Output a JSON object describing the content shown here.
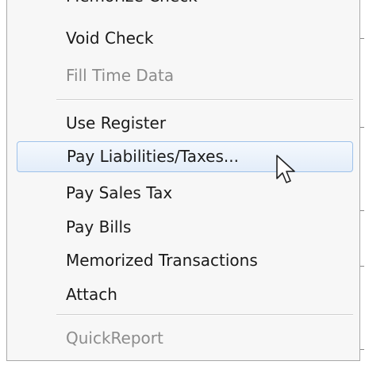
{
  "menu": {
    "clipped_item": "Memorize Check",
    "items": [
      {
        "label": "Void Check",
        "enabled": true
      },
      {
        "label": "Fill Time Data",
        "enabled": false
      },
      {
        "label": "Use Register",
        "enabled": true
      },
      {
        "label": "Pay Liabilities/Taxes...",
        "enabled": true,
        "highlighted": true
      },
      {
        "label": "Pay Sales Tax",
        "enabled": true
      },
      {
        "label": "Pay Bills",
        "enabled": true
      },
      {
        "label": "Memorized Transactions",
        "enabled": true
      },
      {
        "label": "Attach",
        "enabled": true
      },
      {
        "label": "QuickReport",
        "enabled": false
      }
    ]
  },
  "colors": {
    "menu_background": "#f7f7f7",
    "highlight_fill": "#e3edf9",
    "highlight_border": "#9ec1ea",
    "disabled_text": "#8c8c8c"
  },
  "cursor": "arrow-pointer-icon"
}
